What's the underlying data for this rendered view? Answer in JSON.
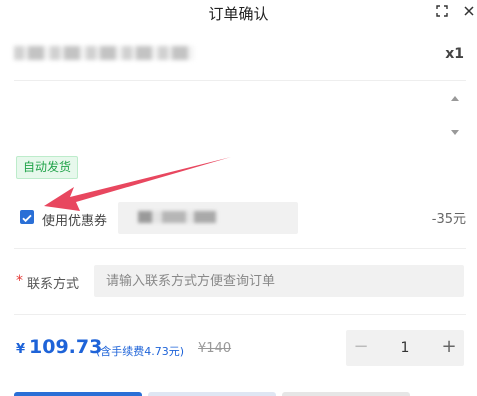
{
  "window": {
    "title": "订单确认",
    "expand_icon": "expand-icon",
    "close_icon": "close-icon"
  },
  "product": {
    "quantity_label": "x1"
  },
  "tag": {
    "auto_delivery": "自动发货"
  },
  "coupon": {
    "checked": true,
    "label": "使用优惠券",
    "discount": "-35元"
  },
  "contact": {
    "label": "联系方式",
    "required_mark": "*",
    "placeholder": "请输入联系方式方便查询订单",
    "value": ""
  },
  "price": {
    "currency": "¥",
    "amount": "109.73",
    "fee_note": "(含手续费4.73元)",
    "original": "¥140"
  },
  "stepper": {
    "minus": "−",
    "value": "1",
    "plus": "+"
  },
  "colors": {
    "accent": "#1e63d8",
    "arrow": "#e8475f",
    "tag_green": "#22a34a"
  }
}
